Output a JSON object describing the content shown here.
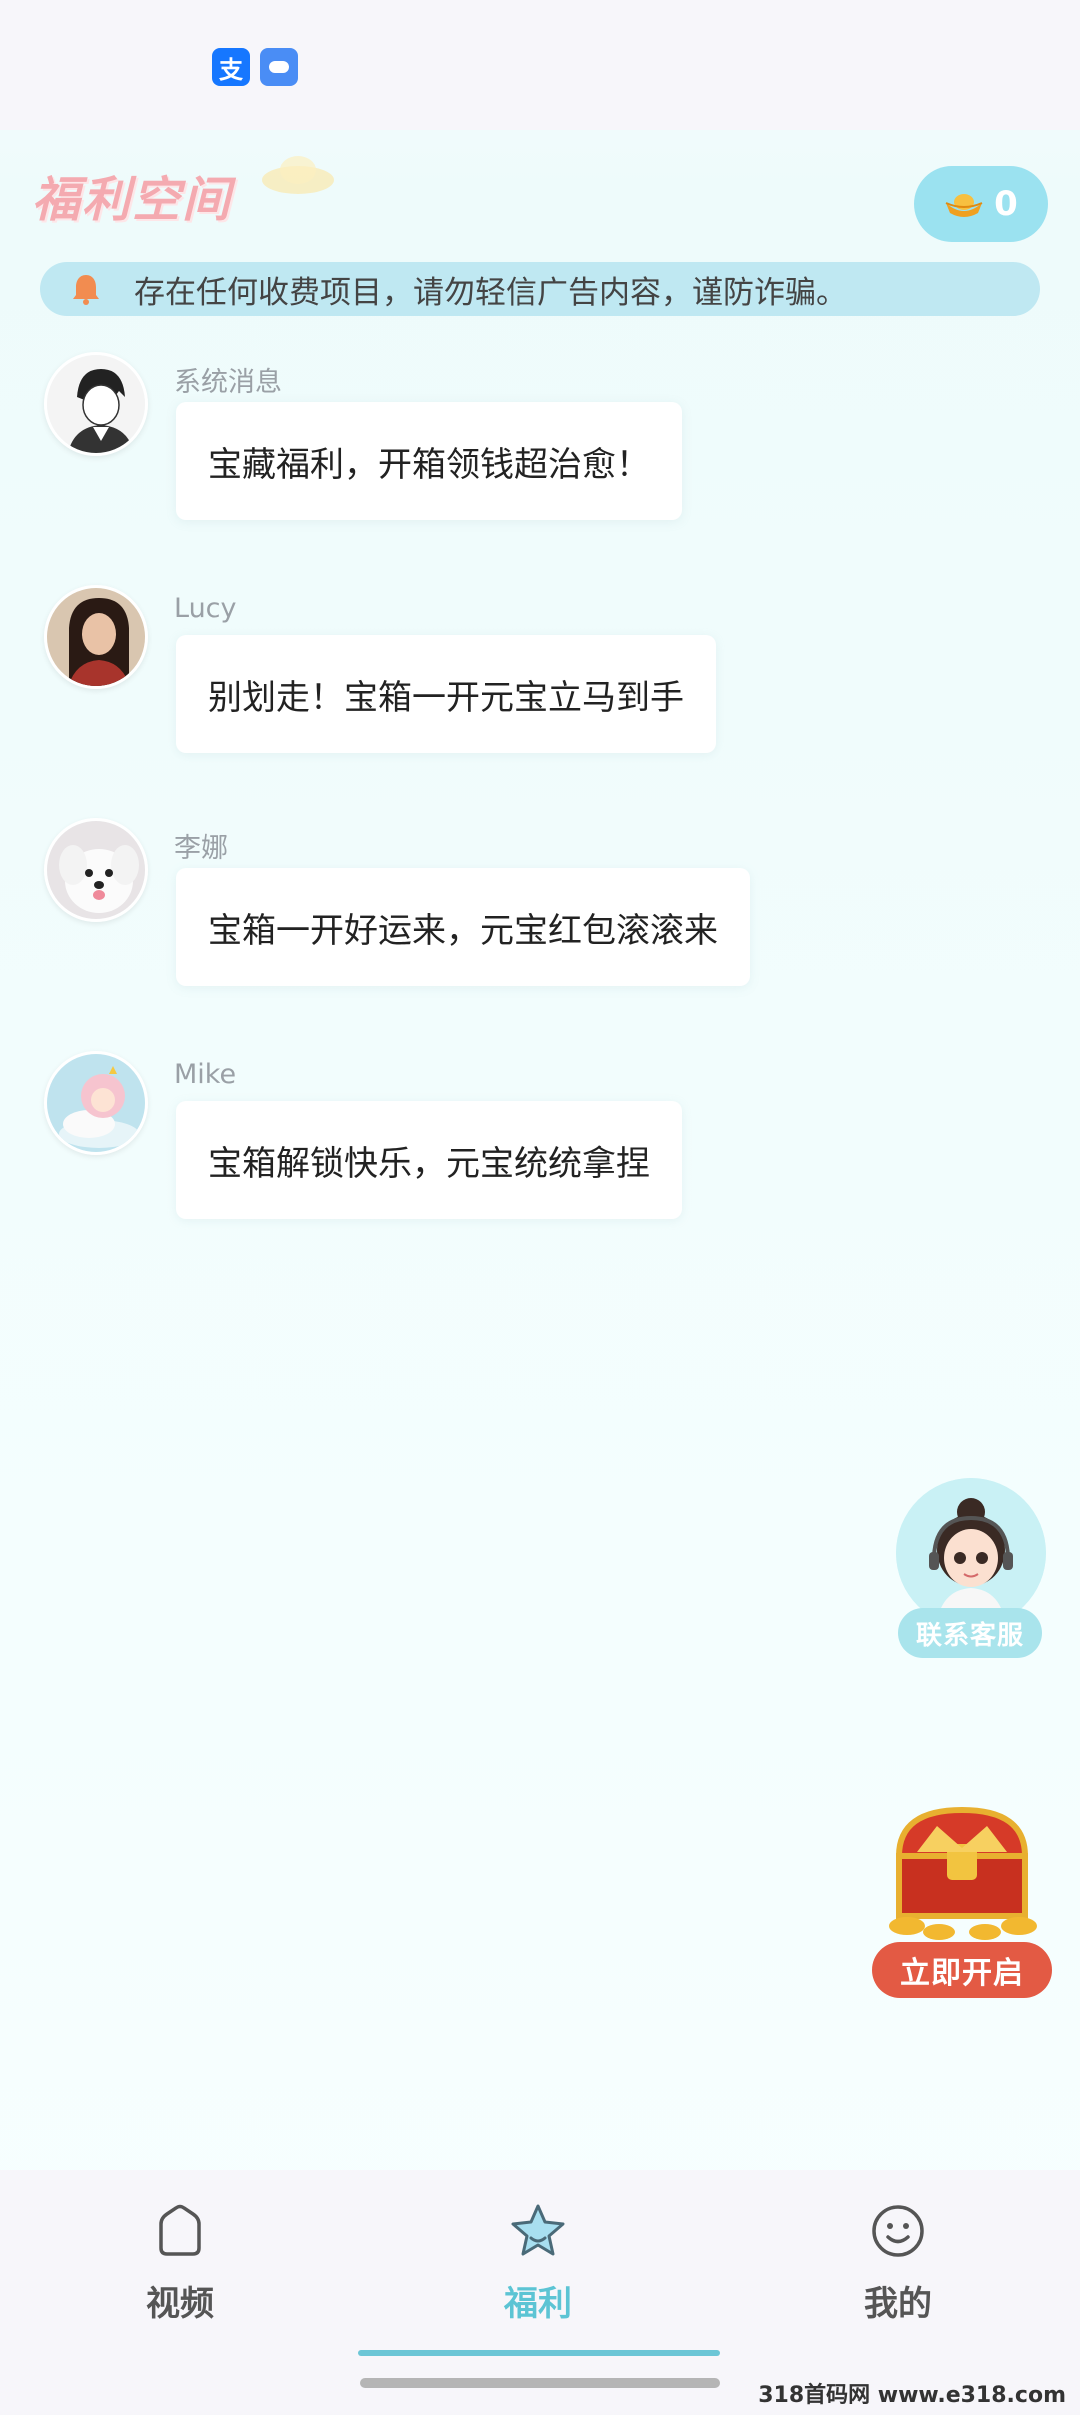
{
  "status_bar": {
    "icons": [
      "alipay-icon",
      "message-icon"
    ],
    "alipay_glyph": "支"
  },
  "header": {
    "logo_text": "福利空间",
    "coin_count": "0"
  },
  "notice": {
    "text": "存在任何收费项目，请勿轻信广告内容，谨防诈骗。"
  },
  "messages": [
    {
      "sender": "系统消息",
      "text": "宝藏福利，开箱领钱超治愈！"
    },
    {
      "sender": "Lucy",
      "text": "别划走！宝箱一开元宝立马到手"
    },
    {
      "sender": "李娜",
      "text": "宝箱一开好运来，元宝红包滚滚来"
    },
    {
      "sender": "Mike",
      "text": "宝箱解锁快乐，元宝统统拿捏"
    }
  ],
  "floating": {
    "customer_service_label": "联系客服",
    "chest_button_label": "立即开启"
  },
  "bottom_nav": {
    "items": [
      {
        "label": "视频",
        "icon": "home-icon",
        "active": false
      },
      {
        "label": "福利",
        "icon": "star-icon",
        "active": true
      },
      {
        "label": "我的",
        "icon": "smile-icon",
        "active": false
      }
    ]
  },
  "watermark": "318首码网 www.e318.com",
  "colors": {
    "accent": "#5cc4d4",
    "notice_bg": "#bfe8f2",
    "chest_button": "#e35a44",
    "logo": "#f4aab0"
  }
}
